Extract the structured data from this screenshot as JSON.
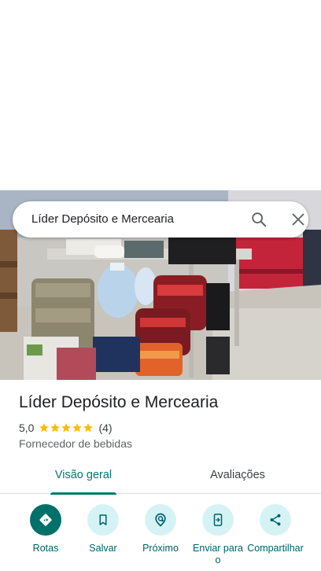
{
  "search": {
    "query": "Líder Depósito e Mercearia"
  },
  "place": {
    "title": "Líder Depósito e Mercearia",
    "rating": "5,0",
    "stars": 5,
    "review_count": "(4)",
    "category": "Fornecedor de bebidas"
  },
  "tabs": [
    {
      "label": "Visão geral",
      "selected": true
    },
    {
      "label": "Avaliações",
      "selected": false
    }
  ],
  "actions": [
    {
      "label": "Rotas",
      "icon": "directions-icon"
    },
    {
      "label": "Salvar",
      "icon": "bookmark-icon"
    },
    {
      "label": "Próximo",
      "icon": "nearby-icon"
    },
    {
      "label": "Enviar para o",
      "icon": "send-to-phone-icon"
    },
    {
      "label": "Compartilhar",
      "icon": "share-icon"
    }
  ],
  "colors": {
    "accent": "#00796b",
    "action_fill": "#d5f3f5",
    "primary_action": "#00706b",
    "star": "#fbbc04"
  }
}
